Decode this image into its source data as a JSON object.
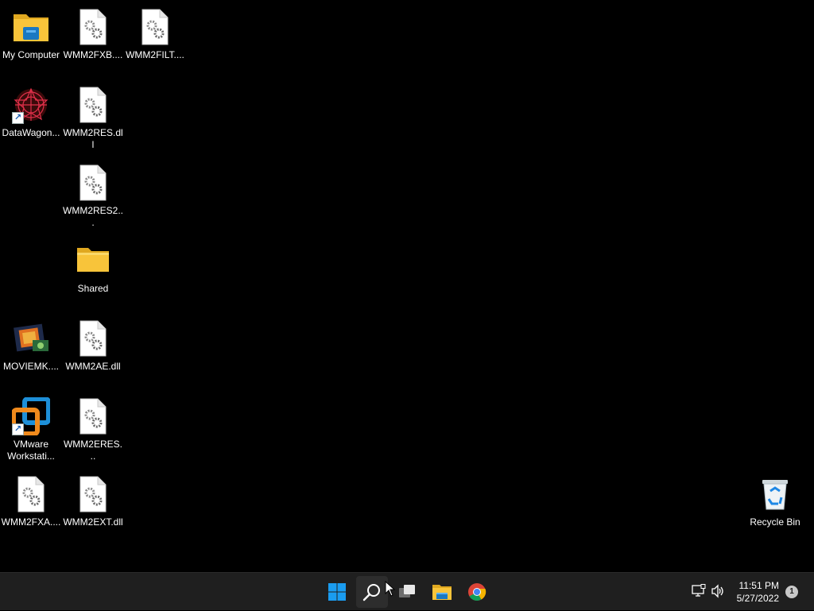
{
  "desktop": {
    "icons": [
      {
        "label": "My Computer",
        "type": "folder-blue"
      },
      {
        "label": "WMM2FXB....",
        "type": "dll"
      },
      {
        "label": "WMM2FILT....",
        "type": "dll"
      },
      {
        "label": "DataWagon...",
        "type": "app-datawagon",
        "shortcut": true
      },
      {
        "label": "WMM2RES.dll",
        "type": "dll"
      },
      {
        "label": "WMM2RES2...",
        "type": "dll"
      },
      {
        "label": "Shared",
        "type": "folder"
      },
      {
        "label": "MOVIEMK....",
        "type": "app-moviemaker"
      },
      {
        "label": "WMM2AE.dll",
        "type": "dll"
      },
      {
        "label": "VMware\nWorkstati...",
        "type": "app-vmware",
        "shortcut": true
      },
      {
        "label": "WMM2ERES...",
        "type": "dll"
      },
      {
        "label": "WMM2FXA....",
        "type": "dll"
      },
      {
        "label": "WMM2EXT.dll",
        "type": "dll"
      },
      {
        "label": "Recycle Bin",
        "type": "recycle-bin"
      }
    ]
  },
  "taskbar": {
    "buttons": [
      {
        "name": "start-button",
        "icon": "windows-logo-icon"
      },
      {
        "name": "search-button",
        "icon": "search-icon"
      },
      {
        "name": "task-view-button",
        "icon": "task-view-icon"
      },
      {
        "name": "file-explorer-button",
        "icon": "file-explorer-icon"
      },
      {
        "name": "chrome-button",
        "icon": "chrome-icon"
      }
    ],
    "tray": {
      "network_icon": "network-icon",
      "volume_icon": "volume-icon",
      "time": "11:51 PM",
      "date": "5/27/2022",
      "notification_count": "1"
    }
  },
  "colors": {
    "desktop_bg": "#000000",
    "taskbar_bg": "#1f1f1f",
    "windows_blue": "#0078d4",
    "folder_yellow": "#f8c43a"
  }
}
